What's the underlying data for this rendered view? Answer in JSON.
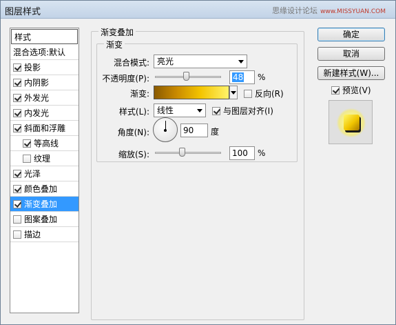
{
  "window": {
    "title": "图层样式"
  },
  "watermark": {
    "text": "思缘设计论坛",
    "site": "www.MISSYUAN.COM"
  },
  "style_list": {
    "header": "样式",
    "blend_options": "混合选项:默认",
    "items": [
      {
        "label": "投影",
        "checked": true,
        "indent": false,
        "selected": false
      },
      {
        "label": "内阴影",
        "checked": true,
        "indent": false,
        "selected": false
      },
      {
        "label": "外发光",
        "checked": true,
        "indent": false,
        "selected": false
      },
      {
        "label": "内发光",
        "checked": true,
        "indent": false,
        "selected": false
      },
      {
        "label": "斜面和浮雕",
        "checked": true,
        "indent": false,
        "selected": false
      },
      {
        "label": "等高线",
        "checked": true,
        "indent": true,
        "selected": false
      },
      {
        "label": "纹理",
        "checked": false,
        "indent": true,
        "selected": false
      },
      {
        "label": "光泽",
        "checked": true,
        "indent": false,
        "selected": false
      },
      {
        "label": "颜色叠加",
        "checked": true,
        "indent": false,
        "selected": false
      },
      {
        "label": "渐变叠加",
        "checked": true,
        "indent": false,
        "selected": true
      },
      {
        "label": "图案叠加",
        "checked": false,
        "indent": false,
        "selected": false
      },
      {
        "label": "描边",
        "checked": false,
        "indent": false,
        "selected": false
      }
    ]
  },
  "panel": {
    "title": "渐变叠加",
    "section_title": "渐变",
    "blend_mode": {
      "label": "混合模式:",
      "value": "亮光"
    },
    "opacity": {
      "label": "不透明度(P):",
      "value": "48",
      "unit": "%",
      "slider_fraction": 0.48
    },
    "gradient": {
      "label": "渐变:",
      "reverse_label": "反向(R)",
      "reverse_checked": false
    },
    "style": {
      "label": "样式(L):",
      "value": "线性",
      "align_label": "与图层对齐(I)",
      "align_checked": true
    },
    "angle": {
      "label": "角度(N):",
      "value": "90",
      "unit": "度"
    },
    "scale": {
      "label": "缩放(S):",
      "value": "100",
      "unit": "%",
      "slider_fraction": 0.42
    }
  },
  "buttons": {
    "ok": "确定",
    "cancel": "取消",
    "new_style": "新建样式(W)...",
    "preview_label": "预览(V)",
    "preview_checked": true
  }
}
